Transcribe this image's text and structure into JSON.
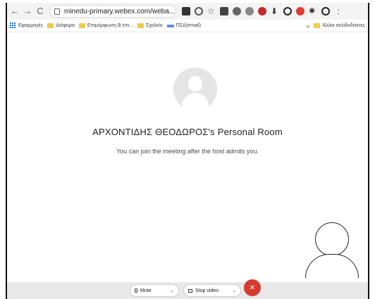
{
  "browser": {
    "url": "minedu-primary.webex.com/weba...",
    "nav": {
      "back": "←",
      "forward": "→",
      "reload": "C"
    },
    "extension_icons": [
      "video-icon",
      "search-icon",
      "star-icon",
      "ext-1-icon",
      "ext-2-icon",
      "ext-3-icon",
      "stop-ext-icon",
      "download-icon",
      "ext-4-icon",
      "ext-5-icon",
      "puzzle-icon",
      "profile-icon"
    ],
    "menu": ":"
  },
  "bookmarks": {
    "items": [
      {
        "label": "Εφαρμογές",
        "icon": "apps-icon"
      },
      {
        "label": "Διάφορα",
        "icon": "folder-icon"
      },
      {
        "label": "Επιμόρφωση Β επι...",
        "icon": "folder-icon"
      },
      {
        "label": "Σχολείο",
        "icon": "folder-icon"
      },
      {
        "label": "ΠΣΔ(email)",
        "icon": "psd-icon"
      }
    ],
    "more": "»",
    "other": {
      "label": "Άλλοι σελιδοδείκτες",
      "icon": "folder-icon"
    }
  },
  "meeting": {
    "room_title": "ΑΡΧΟΝΤΙΔΗΣ ΘΕΟΔΩΡΟΣ's Personal Room",
    "message": "You can join the meeting after the host admits you."
  },
  "controls": {
    "mute_label": "Mute",
    "video_label": "Stop video",
    "chevron": "⌄",
    "end_symbol": "✕"
  },
  "colors": {
    "end_button": "#d73a2f",
    "avatar_bg": "#e5e5e5",
    "controls_bar": "#e8e8e8",
    "folder": "#f2c94c"
  }
}
